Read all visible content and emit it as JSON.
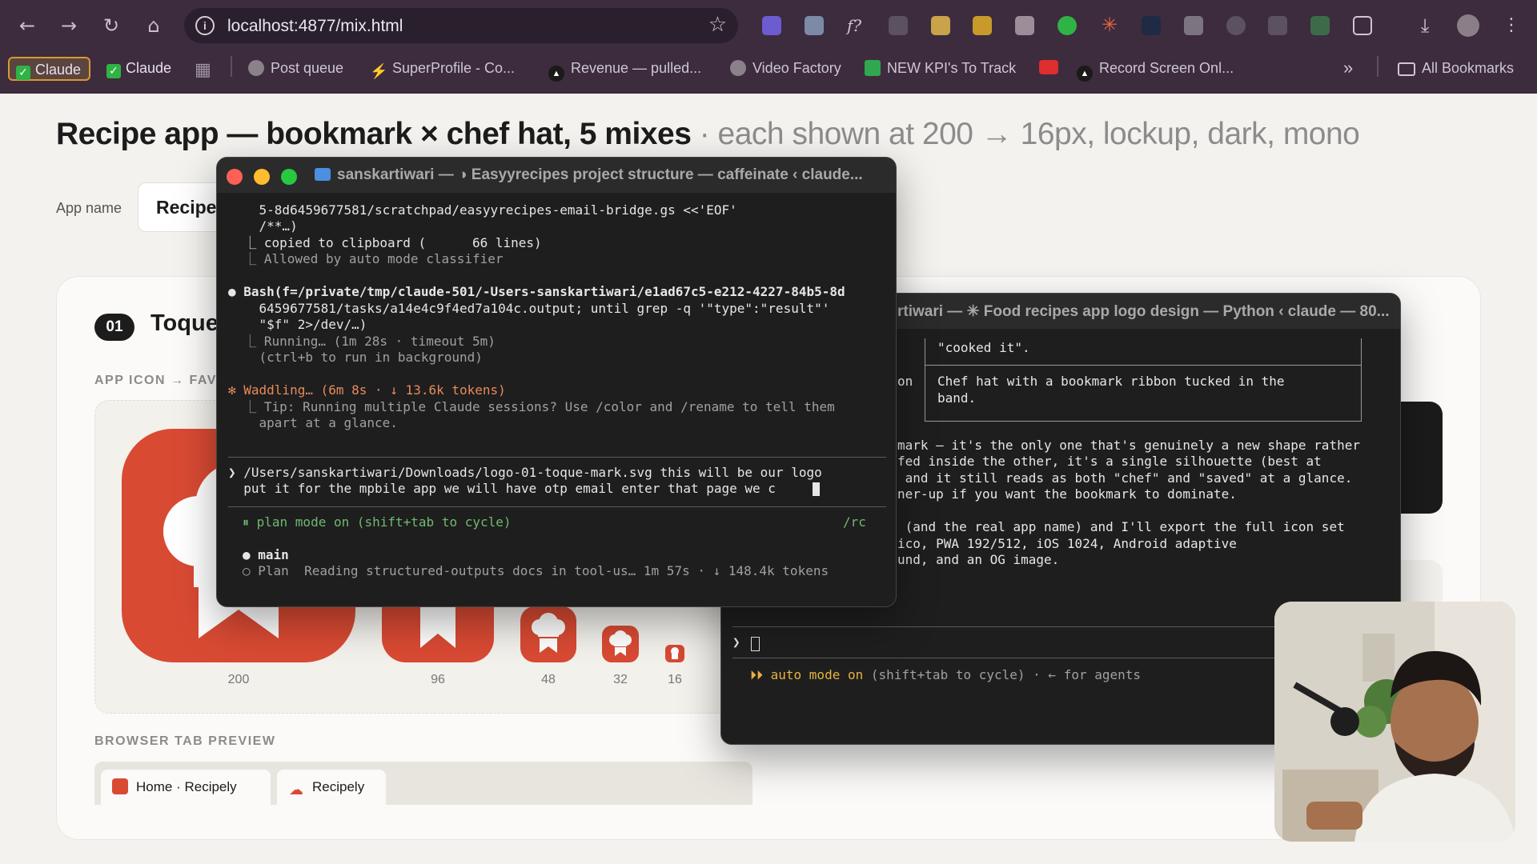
{
  "browser": {
    "url": "localhost:4877/mix.html",
    "nav": {
      "back": "←",
      "forward": "→",
      "reload": "↻",
      "home": "⌂"
    },
    "bookmarks": [
      {
        "label": "Claude",
        "icon": "green-check-icon",
        "active": true
      },
      {
        "label": "Claude",
        "icon": "green-check-icon"
      },
      {
        "label": "Post queue",
        "icon": "globe-icon"
      },
      {
        "label": "SuperProfile - Co...",
        "icon": "lightning-icon"
      },
      {
        "label": "Revenue — pulled...",
        "icon": "triangle-icon"
      },
      {
        "label": "Video Factory",
        "icon": "globe-icon"
      },
      {
        "label": "NEW KPI's To Track",
        "icon": "sheets-icon"
      },
      {
        "label": "Record Screen Onl...",
        "icon": "triangle-icon"
      },
      {
        "label": "All Bookmarks",
        "icon": "folder-icon"
      }
    ],
    "more": "»"
  },
  "page": {
    "title_bold": "Recipe app — bookmark × chef hat, 5 mixes",
    "title_sub": "· each shown at 200 → 16px, lockup, dark, mono",
    "app_name_label": "App name",
    "app_name_value": "Recipel",
    "concept_number": "01",
    "concept_name": "Toque",
    "section_favicon": "APP ICON → FAV",
    "icon_sizes": [
      "200",
      "96",
      "48",
      "32",
      "16"
    ],
    "section_tab": "BROWSER TAB PREVIEW",
    "tabs": [
      {
        "title": "Home",
        "sep": " · ",
        "app": "Recipely"
      },
      {
        "title": "Recipely"
      }
    ],
    "brand_color": "#d94a33"
  },
  "terminal_front": {
    "title": "sanskartiwari — ◑ Easyyrecipes project structure — caffeinate ‹ claude...",
    "lines": [
      "    5-8d6459677581/scratchpad/easyyrecipes-email-bridge.gs <<'EOF'",
      "    /**…)",
      "  ⎿ copied to clipboard (      66 lines)",
      "  ⎿ Allowed by auto mode classifier",
      "",
      "● Bash(f=/private/tmp/claude-501/-Users-sanskartiwari/e1ad67c5-e212-4227-84b5-8d",
      "    6459677581/tasks/a14e4c9f4ed7a104c.output; until grep -q '\"type\":\"result\"'",
      "    \"$f\" 2>/dev/…)",
      "  ⎿ Running… (1m 28s · timeout 5m)",
      "    (ctrl+b to run in background)",
      "",
      "✻ Waddling… (6m 8s · ↓ 13.6k tokens)",
      "  ⎿ Tip: Running multiple Claude sessions? Use /color and /rename to tell them",
      "    apart at a glance."
    ],
    "prompt_lines": [
      "❯ /Users/sanskartiwari/Downloads/logo-01-toque-mark.svg this will be our logo",
      "  put it for the mpbile app we will have otp email enter that page we c"
    ],
    "plan_mode": "⏸ plan mode on (shift+tab to cycle)",
    "rc": "/rc",
    "branch": "main",
    "status": "○ Plan  Reading structured-outputs docs in tool-us… 1m 57s · ↓ 148.4k tokens"
  },
  "terminal_back": {
    "title": "rtiwari — ✳ Food recipes app logo design — Python ‹ claude — 80...",
    "table_rows": [
      {
        "left": "",
        "right": "\"cooked it\"."
      },
      {
        "left": "on",
        "right": "Chef hat with a bookmark ribbon tucked in the\nband."
      }
    ],
    "paragraph1": [
      "mark — it's the only one that's genuinely a new shape rather",
      "fed inside the other, it's a single silhouette (best at",
      " and it still reads as both \"chef\" and \"saved\" at a glance.",
      "ner-up if you want the bookmark to dominate."
    ],
    "paragraph2": [
      " (and the real app name) and I'll export the full icon set",
      "ico, PWA 192/512, iOS 1024, Android adaptive",
      "und, and an OG image."
    ],
    "prompt": "❯",
    "auto_mode": "⏵⏵ auto mode on",
    "auto_mode_rest": " (shift+tab to cycle) · ← for agents"
  }
}
